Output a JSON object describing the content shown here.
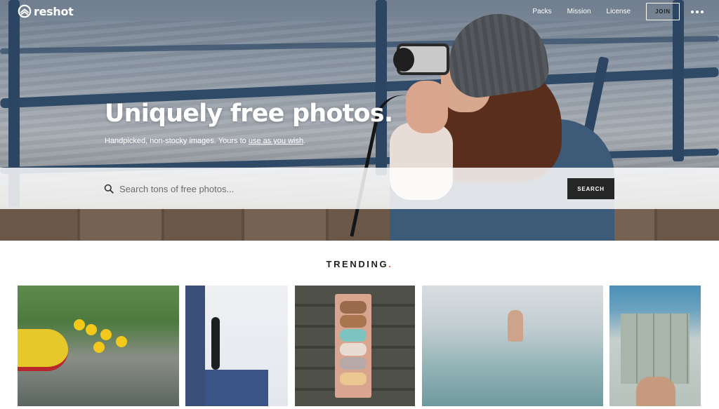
{
  "brand": {
    "name": "reshot"
  },
  "nav": {
    "items": [
      "Packs",
      "Mission",
      "License"
    ],
    "join_label": "JOIN"
  },
  "hero": {
    "headline": "Uniquely free photos.",
    "subline_prefix": "Handpicked, non-stocky images. Yours to ",
    "subline_link": "use as you wish",
    "subline_suffix": "."
  },
  "search": {
    "placeholder": "Search tons of free photos...",
    "button_label": "SEARCH"
  },
  "trending": {
    "label": "TRENDING",
    "dot": "."
  },
  "thumbnails": [
    {
      "subject": "rafting-group"
    },
    {
      "subject": "cactus-silhouette"
    },
    {
      "subject": "macarons-box"
    },
    {
      "subject": "swimmer-in-sea"
    },
    {
      "subject": "tiled-pool-feet"
    }
  ],
  "colors": {
    "accent": "#e85a3a",
    "button": "#262626"
  }
}
